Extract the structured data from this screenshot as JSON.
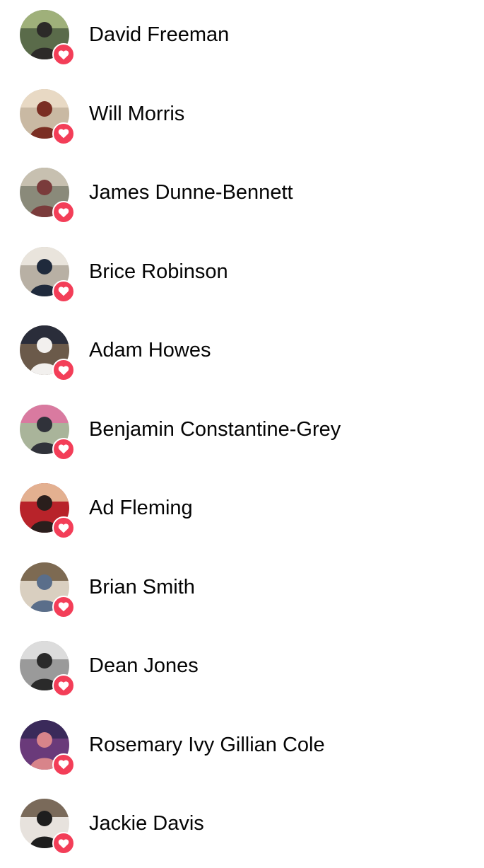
{
  "reactions": {
    "badge_icon": "heart-icon",
    "badge_color": "#f33e58",
    "people": [
      {
        "name": "David Freeman",
        "avatar": {
          "bg": "#5a6b4a",
          "fg": "#2c2a28",
          "accent": "#9fb07a"
        }
      },
      {
        "name": "Will Morris",
        "avatar": {
          "bg": "#c9b9a3",
          "fg": "#7a2e23",
          "accent": "#e8d9c4"
        }
      },
      {
        "name": "James Dunne-Bennett",
        "avatar": {
          "bg": "#8a8a7a",
          "fg": "#7a3b3b",
          "accent": "#c7c0b0"
        }
      },
      {
        "name": "Brice Robinson",
        "avatar": {
          "bg": "#b8b0a4",
          "fg": "#1f2a3c",
          "accent": "#e9e4dc"
        }
      },
      {
        "name": "Adam Howes",
        "avatar": {
          "bg": "#6b5a4a",
          "fg": "#f2f0ee",
          "accent": "#2a2d3a"
        }
      },
      {
        "name": "Benjamin Constantine-Grey",
        "avatar": {
          "bg": "#a9b49a",
          "fg": "#30323a",
          "accent": "#d97aa0"
        }
      },
      {
        "name": "Ad Fleming",
        "avatar": {
          "bg": "#b8232a",
          "fg": "#2a1e1c",
          "accent": "#e3b090"
        }
      },
      {
        "name": "Brian Smith",
        "avatar": {
          "bg": "#d9cfc0",
          "fg": "#5a6e8a",
          "accent": "#7d6a52"
        }
      },
      {
        "name": "Dean Jones",
        "avatar": {
          "bg": "#9a9a9a",
          "fg": "#2a2a2a",
          "accent": "#dcdcdc"
        }
      },
      {
        "name": "Rosemary Ivy Gillian Cole",
        "avatar": {
          "bg": "#6a3a7a",
          "fg": "#d8848a",
          "accent": "#3a2a5a"
        }
      },
      {
        "name": "Jackie Davis",
        "avatar": {
          "bg": "#e7e2dd",
          "fg": "#1e1e1e",
          "accent": "#7a6a5a"
        }
      }
    ]
  }
}
